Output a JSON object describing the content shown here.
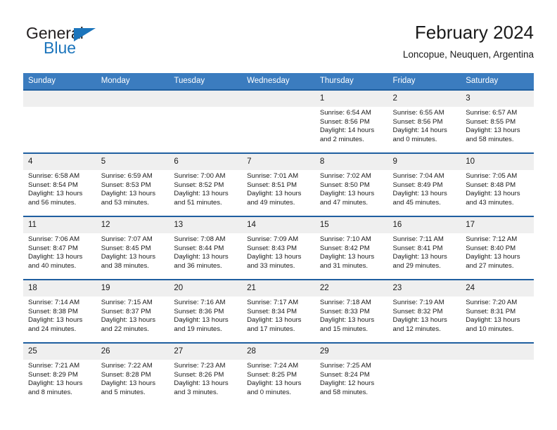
{
  "brand": {
    "name_part1": "General",
    "name_part2": "Blue",
    "flag_icon": "triangle-flag-icon"
  },
  "header": {
    "title": "February 2024",
    "subtitle": "Loncopue, Neuquen, Argentina"
  },
  "colors": {
    "header_blue": "#3b7cbf",
    "row_border_blue": "#1f5fa0",
    "daynum_bg": "#efefef",
    "brand_blue": "#1c75bc"
  },
  "weekday_headers": [
    "Sunday",
    "Monday",
    "Tuesday",
    "Wednesday",
    "Thursday",
    "Friday",
    "Saturday"
  ],
  "weeks": [
    [
      {
        "day": "",
        "sunrise": "",
        "sunset": "",
        "daylight_line1": "",
        "daylight_line2": ""
      },
      {
        "day": "",
        "sunrise": "",
        "sunset": "",
        "daylight_line1": "",
        "daylight_line2": ""
      },
      {
        "day": "",
        "sunrise": "",
        "sunset": "",
        "daylight_line1": "",
        "daylight_line2": ""
      },
      {
        "day": "",
        "sunrise": "",
        "sunset": "",
        "daylight_line1": "",
        "daylight_line2": ""
      },
      {
        "day": "1",
        "sunrise": "Sunrise: 6:54 AM",
        "sunset": "Sunset: 8:56 PM",
        "daylight_line1": "Daylight: 14 hours",
        "daylight_line2": "and 2 minutes."
      },
      {
        "day": "2",
        "sunrise": "Sunrise: 6:55 AM",
        "sunset": "Sunset: 8:56 PM",
        "daylight_line1": "Daylight: 14 hours",
        "daylight_line2": "and 0 minutes."
      },
      {
        "day": "3",
        "sunrise": "Sunrise: 6:57 AM",
        "sunset": "Sunset: 8:55 PM",
        "daylight_line1": "Daylight: 13 hours",
        "daylight_line2": "and 58 minutes."
      }
    ],
    [
      {
        "day": "4",
        "sunrise": "Sunrise: 6:58 AM",
        "sunset": "Sunset: 8:54 PM",
        "daylight_line1": "Daylight: 13 hours",
        "daylight_line2": "and 56 minutes."
      },
      {
        "day": "5",
        "sunrise": "Sunrise: 6:59 AM",
        "sunset": "Sunset: 8:53 PM",
        "daylight_line1": "Daylight: 13 hours",
        "daylight_line2": "and 53 minutes."
      },
      {
        "day": "6",
        "sunrise": "Sunrise: 7:00 AM",
        "sunset": "Sunset: 8:52 PM",
        "daylight_line1": "Daylight: 13 hours",
        "daylight_line2": "and 51 minutes."
      },
      {
        "day": "7",
        "sunrise": "Sunrise: 7:01 AM",
        "sunset": "Sunset: 8:51 PM",
        "daylight_line1": "Daylight: 13 hours",
        "daylight_line2": "and 49 minutes."
      },
      {
        "day": "8",
        "sunrise": "Sunrise: 7:02 AM",
        "sunset": "Sunset: 8:50 PM",
        "daylight_line1": "Daylight: 13 hours",
        "daylight_line2": "and 47 minutes."
      },
      {
        "day": "9",
        "sunrise": "Sunrise: 7:04 AM",
        "sunset": "Sunset: 8:49 PM",
        "daylight_line1": "Daylight: 13 hours",
        "daylight_line2": "and 45 minutes."
      },
      {
        "day": "10",
        "sunrise": "Sunrise: 7:05 AM",
        "sunset": "Sunset: 8:48 PM",
        "daylight_line1": "Daylight: 13 hours",
        "daylight_line2": "and 43 minutes."
      }
    ],
    [
      {
        "day": "11",
        "sunrise": "Sunrise: 7:06 AM",
        "sunset": "Sunset: 8:47 PM",
        "daylight_line1": "Daylight: 13 hours",
        "daylight_line2": "and 40 minutes."
      },
      {
        "day": "12",
        "sunrise": "Sunrise: 7:07 AM",
        "sunset": "Sunset: 8:45 PM",
        "daylight_line1": "Daylight: 13 hours",
        "daylight_line2": "and 38 minutes."
      },
      {
        "day": "13",
        "sunrise": "Sunrise: 7:08 AM",
        "sunset": "Sunset: 8:44 PM",
        "daylight_line1": "Daylight: 13 hours",
        "daylight_line2": "and 36 minutes."
      },
      {
        "day": "14",
        "sunrise": "Sunrise: 7:09 AM",
        "sunset": "Sunset: 8:43 PM",
        "daylight_line1": "Daylight: 13 hours",
        "daylight_line2": "and 33 minutes."
      },
      {
        "day": "15",
        "sunrise": "Sunrise: 7:10 AM",
        "sunset": "Sunset: 8:42 PM",
        "daylight_line1": "Daylight: 13 hours",
        "daylight_line2": "and 31 minutes."
      },
      {
        "day": "16",
        "sunrise": "Sunrise: 7:11 AM",
        "sunset": "Sunset: 8:41 PM",
        "daylight_line1": "Daylight: 13 hours",
        "daylight_line2": "and 29 minutes."
      },
      {
        "day": "17",
        "sunrise": "Sunrise: 7:12 AM",
        "sunset": "Sunset: 8:40 PM",
        "daylight_line1": "Daylight: 13 hours",
        "daylight_line2": "and 27 minutes."
      }
    ],
    [
      {
        "day": "18",
        "sunrise": "Sunrise: 7:14 AM",
        "sunset": "Sunset: 8:38 PM",
        "daylight_line1": "Daylight: 13 hours",
        "daylight_line2": "and 24 minutes."
      },
      {
        "day": "19",
        "sunrise": "Sunrise: 7:15 AM",
        "sunset": "Sunset: 8:37 PM",
        "daylight_line1": "Daylight: 13 hours",
        "daylight_line2": "and 22 minutes."
      },
      {
        "day": "20",
        "sunrise": "Sunrise: 7:16 AM",
        "sunset": "Sunset: 8:36 PM",
        "daylight_line1": "Daylight: 13 hours",
        "daylight_line2": "and 19 minutes."
      },
      {
        "day": "21",
        "sunrise": "Sunrise: 7:17 AM",
        "sunset": "Sunset: 8:34 PM",
        "daylight_line1": "Daylight: 13 hours",
        "daylight_line2": "and 17 minutes."
      },
      {
        "day": "22",
        "sunrise": "Sunrise: 7:18 AM",
        "sunset": "Sunset: 8:33 PM",
        "daylight_line1": "Daylight: 13 hours",
        "daylight_line2": "and 15 minutes."
      },
      {
        "day": "23",
        "sunrise": "Sunrise: 7:19 AM",
        "sunset": "Sunset: 8:32 PM",
        "daylight_line1": "Daylight: 13 hours",
        "daylight_line2": "and 12 minutes."
      },
      {
        "day": "24",
        "sunrise": "Sunrise: 7:20 AM",
        "sunset": "Sunset: 8:31 PM",
        "daylight_line1": "Daylight: 13 hours",
        "daylight_line2": "and 10 minutes."
      }
    ],
    [
      {
        "day": "25",
        "sunrise": "Sunrise: 7:21 AM",
        "sunset": "Sunset: 8:29 PM",
        "daylight_line1": "Daylight: 13 hours",
        "daylight_line2": "and 8 minutes."
      },
      {
        "day": "26",
        "sunrise": "Sunrise: 7:22 AM",
        "sunset": "Sunset: 8:28 PM",
        "daylight_line1": "Daylight: 13 hours",
        "daylight_line2": "and 5 minutes."
      },
      {
        "day": "27",
        "sunrise": "Sunrise: 7:23 AM",
        "sunset": "Sunset: 8:26 PM",
        "daylight_line1": "Daylight: 13 hours",
        "daylight_line2": "and 3 minutes."
      },
      {
        "day": "28",
        "sunrise": "Sunrise: 7:24 AM",
        "sunset": "Sunset: 8:25 PM",
        "daylight_line1": "Daylight: 13 hours",
        "daylight_line2": "and 0 minutes."
      },
      {
        "day": "29",
        "sunrise": "Sunrise: 7:25 AM",
        "sunset": "Sunset: 8:24 PM",
        "daylight_line1": "Daylight: 12 hours",
        "daylight_line2": "and 58 minutes."
      },
      {
        "day": "",
        "sunrise": "",
        "sunset": "",
        "daylight_line1": "",
        "daylight_line2": ""
      },
      {
        "day": "",
        "sunrise": "",
        "sunset": "",
        "daylight_line1": "",
        "daylight_line2": ""
      }
    ]
  ]
}
